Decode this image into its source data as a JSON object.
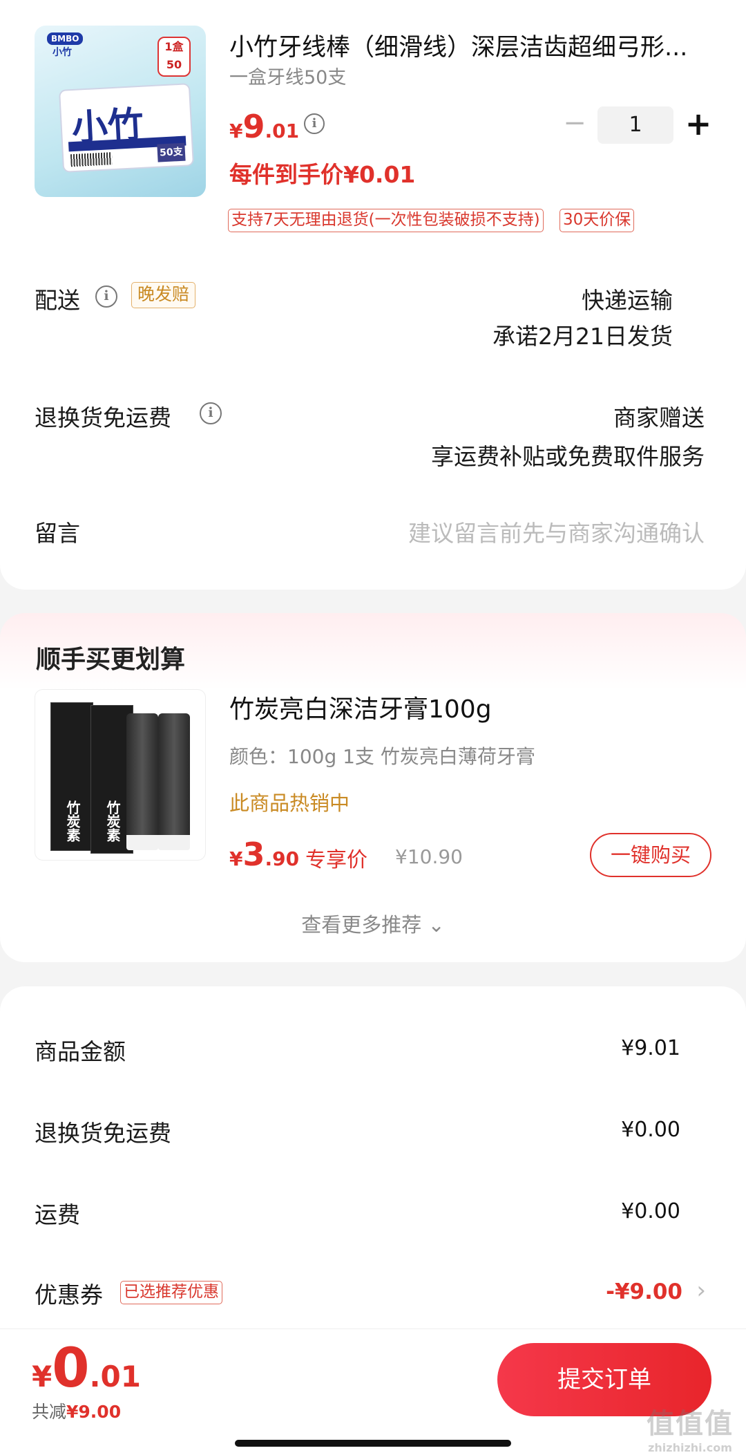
{
  "product": {
    "title": "小竹牙线棒（细滑线）深层洁齿超细弓形...",
    "subtitle": "一盒牙线50支",
    "image_text": {
      "brand": "BMBO",
      "brand_cn": "小竹",
      "name": "小竹",
      "count": "50支",
      "badge": "1盒 50"
    },
    "price_currency": "¥",
    "price_int": "9",
    "price_dec": ".01",
    "quantity": "1",
    "minus_label": "−",
    "plus_label": "+",
    "each_price": "每件到手价¥0.01",
    "tags": [
      "支持7天无理由退货(一次性包装破损不支持)",
      "30天价保"
    ]
  },
  "delivery": {
    "label": "配送",
    "badge": "晚发赔",
    "method": "快递运输",
    "promise": "承诺2月21日发货"
  },
  "return_shipping": {
    "label": "退换货免运费",
    "value": "商家赠送",
    "desc": "享运费补贴或免费取件服务"
  },
  "message": {
    "label": "留言",
    "placeholder": "建议留言前先与商家沟通确认"
  },
  "recommend": {
    "section_title": "顺手买更划算",
    "name": "竹炭亮白深洁牙膏100g",
    "color": "颜色：100g 1支 竹炭亮白薄荷牙膏",
    "hot": "此商品热销中",
    "price_currency": "¥",
    "price_int": "3",
    "price_dec": ".90",
    "exclusive": "专享价",
    "original": "¥10.90",
    "buy_label": "一键购买",
    "see_more": "查看更多推荐 ⌄",
    "image_text": "竹炭素"
  },
  "summary": {
    "goods_label": "商品金额",
    "goods_value": "¥9.01",
    "return_label": "退换货免运费",
    "return_value": "¥0.00",
    "shipping_label": "运费",
    "shipping_value": "¥0.00",
    "coupon_label": "优惠券",
    "coupon_badge": "已选推荐优惠",
    "coupon_value": "-¥9.00"
  },
  "footer": {
    "currency": "¥",
    "total_int": "0",
    "total_dec": ".01",
    "reduced_label": "共减",
    "reduced_value": "¥9.00",
    "submit_label": "提交订单"
  },
  "watermark": {
    "big": "值值值",
    "small": "zhizhizhi.com"
  },
  "colors": {
    "accent": "#e0312b",
    "gold": "#c98a23",
    "background": "#f4f4f4"
  }
}
